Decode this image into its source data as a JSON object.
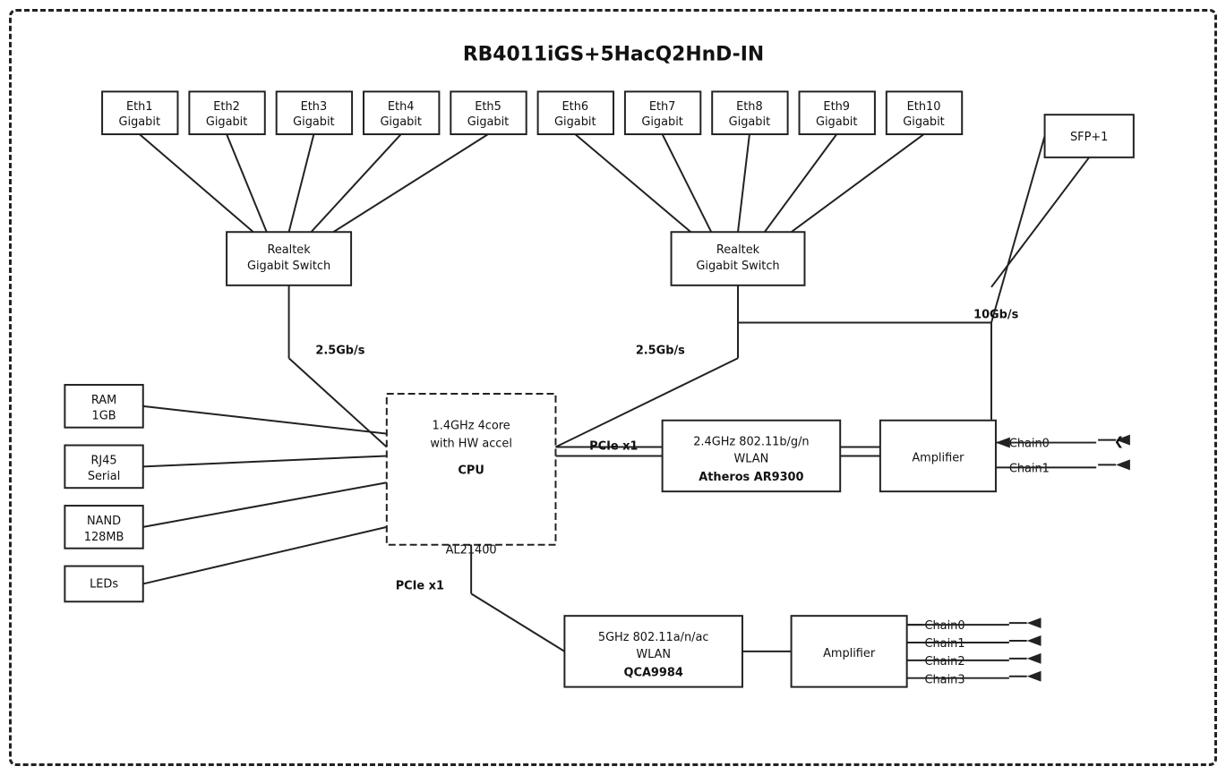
{
  "title": "RB4011iGS+5HacQ2HnD-IN",
  "eth_ports_left": [
    {
      "label": "Eth1",
      "sub": "Gigabit"
    },
    {
      "label": "Eth2",
      "sub": "Gigabit"
    },
    {
      "label": "Eth3",
      "sub": "Gigabit"
    },
    {
      "label": "Eth4",
      "sub": "Gigabit"
    },
    {
      "label": "Eth5",
      "sub": "Gigabit"
    }
  ],
  "eth_ports_right": [
    {
      "label": "Eth6",
      "sub": "Gigabit"
    },
    {
      "label": "Eth7",
      "sub": "Gigabit"
    },
    {
      "label": "Eth8",
      "sub": "Gigabit"
    },
    {
      "label": "Eth9",
      "sub": "Gigabit"
    },
    {
      "label": "Eth10",
      "sub": "Gigabit"
    }
  ],
  "sfp": "SFP+1",
  "switch_left": {
    "line1": "Realtek",
    "line2": "Gigabit Switch"
  },
  "switch_right": {
    "line1": "Realtek",
    "line2": "Gigabit Switch"
  },
  "cpu": {
    "line1": "1.4GHz 4core",
    "line2": "with HW accel",
    "bold": "CPU",
    "model": "AL21400"
  },
  "wlan1": {
    "line1": "2.4GHz 802.11b/g/n",
    "line2": "WLAN",
    "bold": "Atheros AR9300"
  },
  "wlan2": {
    "line1": "5GHz 802.11a/n/ac",
    "line2": "WLAN",
    "bold": "QCA9984"
  },
  "amplifier1": "Amplifier",
  "amplifier2": "Amplifier",
  "ram": {
    "line1": "RAM",
    "line2": "1GB"
  },
  "rj45": {
    "line1": "RJ45",
    "line2": "Serial"
  },
  "nand": {
    "line1": "NAND",
    "line2": "128MB"
  },
  "leds": "LEDs",
  "speed_left": "2.5Gb/s",
  "speed_right": "2.5Gb/s",
  "speed_sfp": "10Gb/s",
  "pcie1": "PCIe x1",
  "pcie2": "PCIe x1",
  "chains_top": [
    "Chain0",
    "Chain1"
  ],
  "chains_bottom": [
    "Chain0",
    "Chain1",
    "Chain2",
    "Chain3"
  ]
}
